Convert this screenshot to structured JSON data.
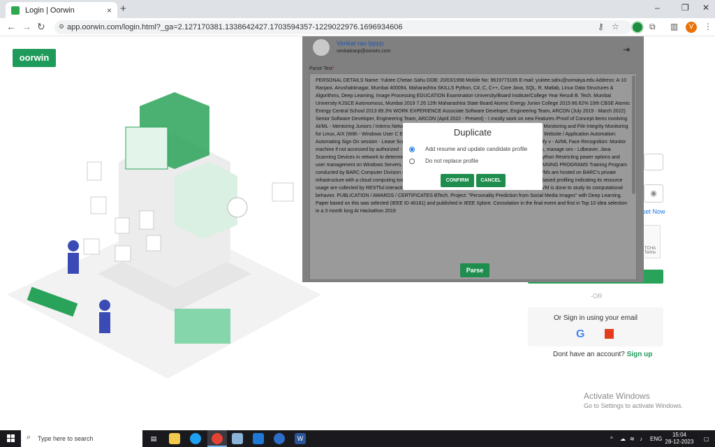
{
  "browser": {
    "tab_title": "Login | Oorwin",
    "tab_close": "×",
    "new_tab": "+",
    "url": "app.oorwin.com/login.html?_ga=2.127170381.1338642427.1703594357-1229022976.1696934606",
    "profile_initial": "V",
    "window_buttons": [
      "–",
      "❐",
      "✕"
    ]
  },
  "page": {
    "logo_text": "oorwin",
    "forgot_reset": "set Now",
    "captcha_text": "TCHA Terms",
    "or_text": "-OR",
    "sso_text": "Or Sign in using your email",
    "google_letter": "G",
    "account_text": "Dont have an account?",
    "signup_link": "Sign up",
    "activate_title": "Activate Windows",
    "activate_sub": "Go to Settings to activate Windows."
  },
  "modal": {
    "user_name": "Venkat rao lpppp",
    "user_email": "venkatraop@oorwin.com",
    "parse_label": "Parse Text",
    "parse_text": "PERSONAL DETAILS Name: Yuktee Chetan Sahu DOB: 20/03/1998 Mobile No: 9619773165 E-mail: yuktee.sahu@somaiya.edu Address: A-10 Ranjani, Anushaktinagar, Mumbai 400094, Maharashtra SKILLS Python, C#, C, C++, Core Java, SQL, R, Matlab, Linux Data Structures & Algorithms, Deep Learning, Image Processing EDUCATION Examination University/Board Institute/College Year Result B. Tech. Mumbai University KJSCE Autonomous, Mumbai 2019 7.26 12th Maharashtra State Board Atomic Energy Junior College 2015 86.62% 10th CBSE Atomic Energy Central School 2013 89.3% WORK EXPERIENCE Associate Software Developer, Engineering Team, ARCON (July 2019 - March 2022) Senior Software Developer, Engineering Team, ARCON (April 2022 - Present) - I mostly work on new Features /Proof of Concept items involving AI/ML - Mentoring Juniors / Interns Network Monitoring of End-Points and Visualization - AI/ML End-Point Monitoring and File Integrity Monitoring for Linux, AIX (With - Windows User C External Users' Authentication, Authorization to internal - ASP .Net Website / Application Automation: Automating Sign On session - Lease Script Inspection, Consolidation C#, Python KYC automation: Classify v - AI/ML Face Recognition: Monitor machine if not accessed by authorized - Extract Text, Python, AI/ML Incorporate rules and logs for queries, manage ses - Ldbeaver, Java Scanning Devices in network to determine device type and C - Usage, Keystrokes, Applications usage. Python Restricting power options and user management on Windows Servers. C# Images to Video - Real Time Streaming INTERNSHIPS / TRAINING PROGRAMS Training Program conducted by BARC Computer Division (June-July 2018) Virtual Machine Profiling and its visualization : VMs are hosted on BARC's private infrastructure with a cloud computing toolkit called Openstack. VM's basic information and its time series based profiling indicating its resource usage are collected by RESTful interaction with service APIs of Openstack. Visualization and analysis of VM is done to study its computational behavior. PUBLICATION / AWARDS / CERTIFICATES BTech. Project: \"Personality Prediction from Social Media Images\" with Deep Learning. Paper based on this was selected (IEEE ID 46181) and published in IEEE Xplore. Consolation in the final event and first in Top 10 idea selection in a 3 month long AI Hackathon 2019",
    "parse_button": "Parse"
  },
  "dialog": {
    "title": "Duplicate",
    "option1": "Add resume and update candidate profile",
    "option2": "Do not replace profile",
    "selected": "option1",
    "confirm": "CONFIRM",
    "cancel": "CANCEL"
  },
  "taskbar": {
    "search_placeholder": "Type here to search",
    "language": "ENG",
    "time": "15:04",
    "date": "28-12-2023",
    "tray_up": "^"
  },
  "colors": {
    "brand_green": "#1e9a5a",
    "button_green": "#1f8d4d",
    "link_blue": "#1a73e8"
  }
}
